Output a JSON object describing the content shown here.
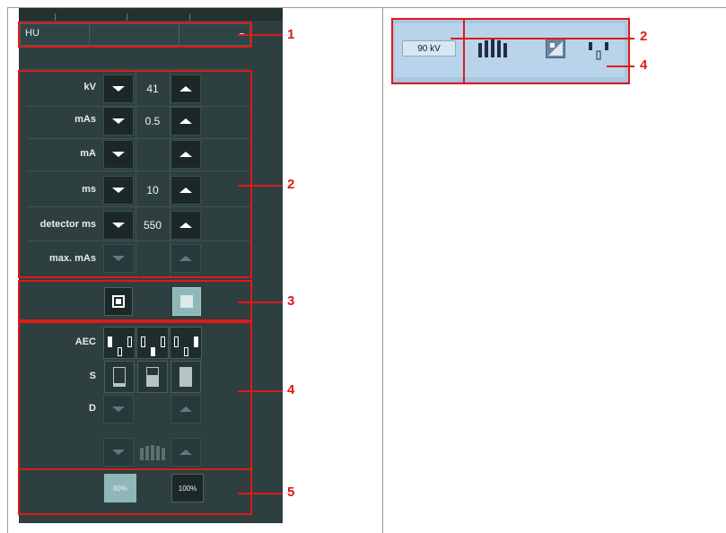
{
  "console": {
    "hu_label": "HU",
    "params": [
      {
        "label": "kV",
        "value": "41",
        "enabled": true
      },
      {
        "label": "mAs",
        "value": "0.5",
        "enabled": true
      },
      {
        "label": "mA",
        "value": "",
        "enabled": true
      },
      {
        "label": "ms",
        "value": "10",
        "enabled": true
      },
      {
        "label": "detector ms",
        "value": "550",
        "enabled": true
      },
      {
        "label": "max. mAs",
        "value": "",
        "enabled": false
      }
    ],
    "aec_label": "AEC",
    "s_label": "S",
    "d_label": "D",
    "pct_80": "80%",
    "pct_100": "100%"
  },
  "right_panel": {
    "kv_button": "90 kV"
  },
  "callouts": {
    "n1": "1",
    "n2": "2",
    "n3": "3",
    "n4": "4",
    "n5": "5",
    "r2": "2",
    "r4": "4"
  },
  "colors": {
    "annotation": "#e01919",
    "panel_bg": "#2d3f3f",
    "right_panel_bg": "#a7c8e2"
  }
}
